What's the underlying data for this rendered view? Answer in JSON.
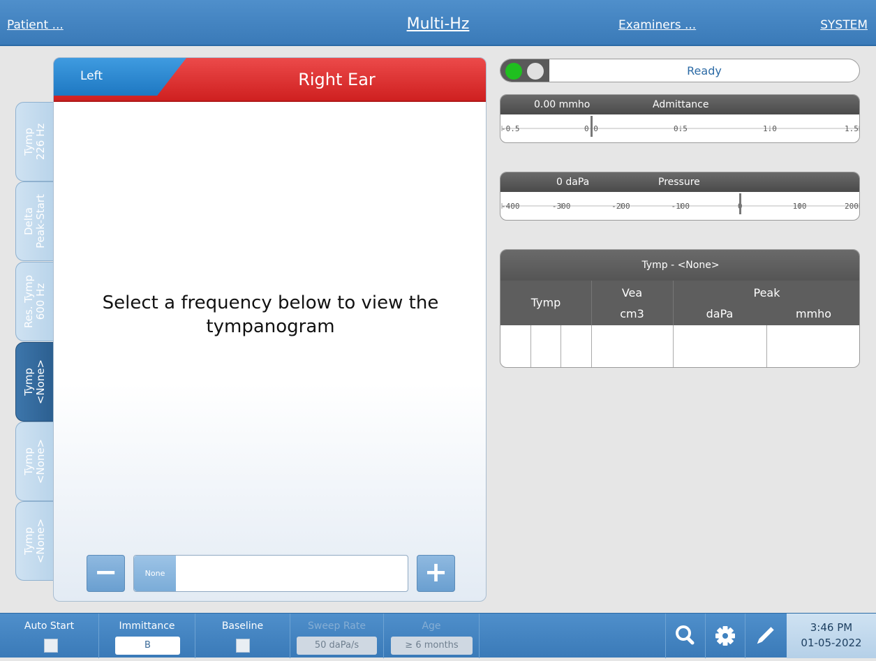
{
  "topbar": {
    "patient": "Patient ...",
    "title": "Multi-Hz",
    "examiners": "Examiners ...",
    "system": "SYSTEM"
  },
  "side_tabs": [
    {
      "line1": "Tymp",
      "line2": "226 Hz",
      "active": false
    },
    {
      "line1": "Delta",
      "line2": "Peak-Start",
      "active": false
    },
    {
      "line1": "Res. Tymp",
      "line2": "600 Hz",
      "active": false
    },
    {
      "line1": "Tymp",
      "line2": "<None>",
      "active": true
    },
    {
      "line1": "Tymp",
      "line2": "<None>",
      "active": false
    },
    {
      "line1": "Tymp",
      "line2": "<None>",
      "active": false
    }
  ],
  "panel": {
    "left_button": "Left",
    "ear_label": "Right Ear",
    "message_line1": "Select a frequency below to view the",
    "message_line2": "tympanogram",
    "minus": "−",
    "plus": "+",
    "freq_value": "None"
  },
  "status": {
    "text": "Ready",
    "light1_color": "#1fbf1f",
    "light2_color": "#e0e0e0"
  },
  "admittance": {
    "value": "0.00 mmho",
    "label": "Admittance",
    "ticks": [
      "-0.5",
      "0.0",
      "0.5",
      "1.0",
      "1.5"
    ],
    "needle_value": 0.0
  },
  "pressure": {
    "value": "0 daPa",
    "label": "Pressure",
    "ticks": [
      "-400",
      "-300",
      "-200",
      "-100",
      "0",
      "100",
      "200"
    ],
    "needle_value": 0
  },
  "table": {
    "title": "Tymp - <None>",
    "col_tymp": "Tymp",
    "col_vea": "Vea",
    "col_vea_unit": "cm3",
    "col_peak": "Peak",
    "col_peak_dapa": "daPa",
    "col_peak_mmho": "mmho"
  },
  "bottombar": {
    "auto_start": "Auto Start",
    "immittance": "Immittance",
    "immittance_value": "B",
    "baseline": "Baseline",
    "sweep_rate": "Sweep Rate",
    "sweep_rate_value": "50 daPa/s",
    "age": "Age",
    "age_value": "≥ 6 months",
    "icons": [
      "search-icon",
      "gear-icon",
      "pencil-icon"
    ],
    "time": "3:46 PM",
    "date": "01-05-2022"
  }
}
